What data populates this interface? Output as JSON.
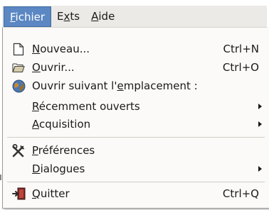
{
  "menubar": {
    "fichier": "Fichier",
    "exts": "Exts",
    "aide": "Aide"
  },
  "menu": {
    "nouveau": {
      "label": "Nouveau...",
      "accel": "Ctrl+N",
      "icon": "new-document-icon"
    },
    "ouvrir": {
      "label": "Ouvrir...",
      "accel": "Ctrl+O",
      "icon": "folder-open-icon"
    },
    "ouvrir_emplacement": {
      "label": "Ouvrir suivant l'emplacement :",
      "icon": "globe-icon"
    },
    "recents": {
      "label": "Récemment ouverts"
    },
    "acquisition": {
      "label": "Acquisition"
    },
    "preferences": {
      "label": "Préférences",
      "icon": "tools-icon"
    },
    "dialogues": {
      "label": "Dialogues"
    },
    "quitter": {
      "label": "Quitter",
      "accel": "Ctrl+Q",
      "icon": "quit-icon"
    }
  },
  "colors": {
    "highlight": "#5b87c3",
    "menubar_bg": "#eceae6",
    "menu_bg": "#fbfaf8"
  }
}
